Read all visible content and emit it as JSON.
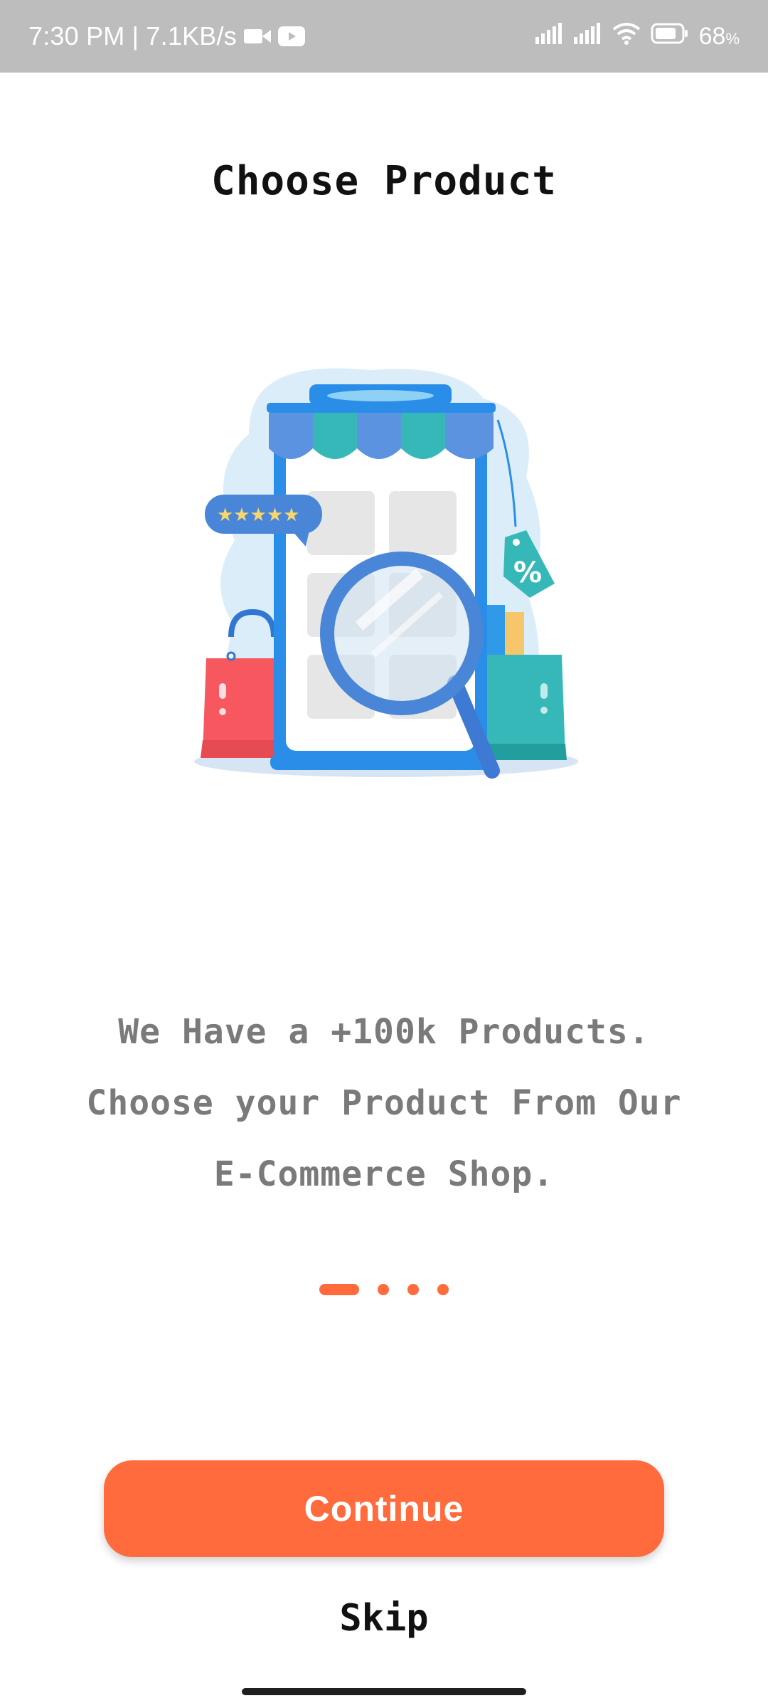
{
  "status_bar": {
    "time_speed": "7:30 PM | 7.1KB/s",
    "battery_percent": "68",
    "battery_percent_sign": "%",
    "icons": [
      "video-camera-icon",
      "youtube-icon",
      "signal-icon",
      "signal-icon",
      "wifi-icon",
      "battery-icon"
    ]
  },
  "title": "Choose Product",
  "description": {
    "line1": "We Have a +100k Products.",
    "line2": "Choose your Product From Our",
    "line3": "E-Commerce Shop."
  },
  "pager": {
    "total": 4,
    "current": 1
  },
  "buttons": {
    "continue": "Continue",
    "skip": "Skip"
  },
  "colors": {
    "accent": "#ff6b3d",
    "status_bar": "#bdbdbd",
    "description_text": "#7a7a7a"
  }
}
